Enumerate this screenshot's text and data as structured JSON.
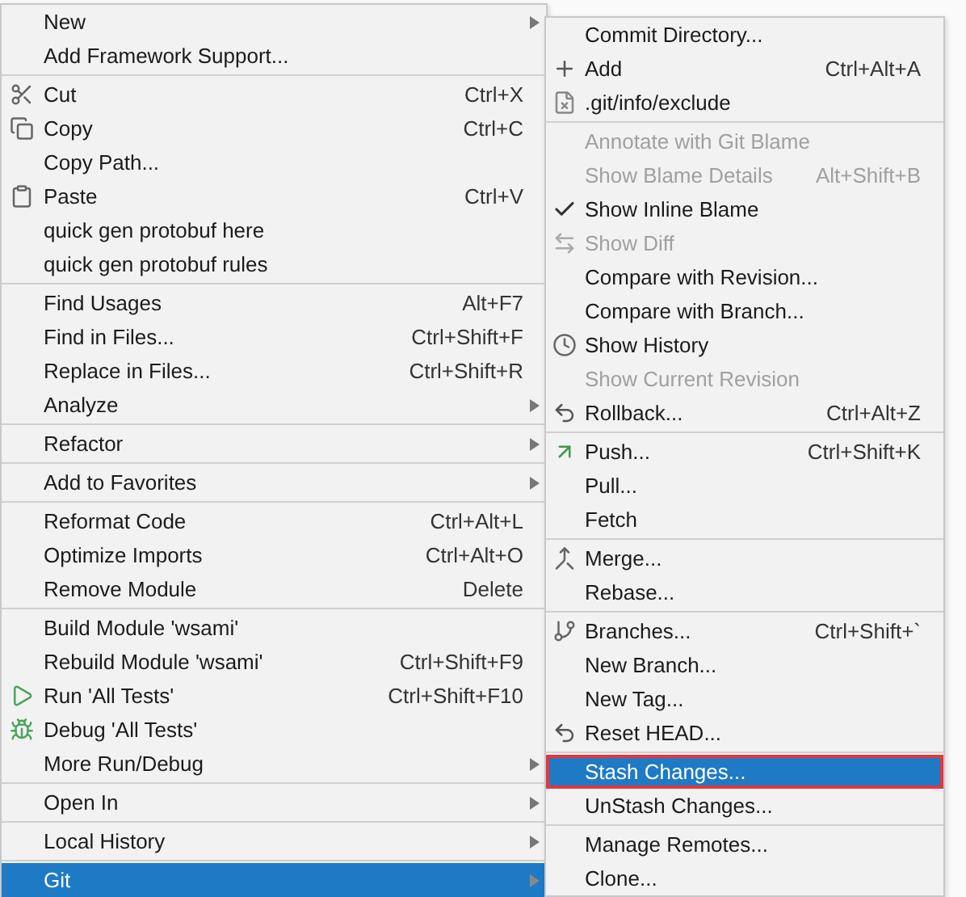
{
  "context_menu": {
    "groups": [
      [
        {
          "label": "New",
          "kind": "plain",
          "submenu": true,
          "selected": false
        },
        {
          "label": "Add Framework Support...",
          "kind": "plain",
          "selected": false
        }
      ],
      [
        {
          "label": "Cut",
          "shortcut": "Ctrl+X",
          "kind": "scissors",
          "selected": false
        },
        {
          "label": "Copy",
          "shortcut": "Ctrl+C",
          "kind": "copy",
          "selected": false
        },
        {
          "label": "Copy Path...",
          "kind": "plain",
          "selected": false
        },
        {
          "label": "Paste",
          "shortcut": "Ctrl+V",
          "kind": "paste",
          "selected": false
        },
        {
          "label": "quick gen protobuf here",
          "kind": "plain",
          "selected": false
        },
        {
          "label": "quick gen protobuf rules",
          "kind": "plain",
          "selected": false
        }
      ],
      [
        {
          "label": "Find Usages",
          "shortcut": "Alt+F7",
          "kind": "plain",
          "selected": false
        },
        {
          "label": "Find in Files...",
          "shortcut": "Ctrl+Shift+F",
          "kind": "plain",
          "selected": false
        },
        {
          "label": "Replace in Files...",
          "shortcut": "Ctrl+Shift+R",
          "kind": "plain",
          "selected": false
        },
        {
          "label": "Analyze",
          "kind": "plain",
          "submenu": true,
          "selected": false
        }
      ],
      [
        {
          "label": "Refactor",
          "kind": "plain",
          "submenu": true,
          "selected": false
        }
      ],
      [
        {
          "label": "Add to Favorites",
          "kind": "plain",
          "submenu": true,
          "selected": false
        }
      ],
      [
        {
          "label": "Reformat Code",
          "shortcut": "Ctrl+Alt+L",
          "kind": "plain",
          "selected": false
        },
        {
          "label": "Optimize Imports",
          "shortcut": "Ctrl+Alt+O",
          "kind": "plain",
          "selected": false
        },
        {
          "label": "Remove Module",
          "shortcut": "Delete",
          "kind": "plain",
          "selected": false
        }
      ],
      [
        {
          "label": "Build Module 'wsami'",
          "kind": "plain",
          "selected": false
        },
        {
          "label": "Rebuild Module 'wsami'",
          "shortcut": "Ctrl+Shift+F9",
          "kind": "plain",
          "selected": false
        },
        {
          "label": "Run 'All Tests'",
          "shortcut": "Ctrl+Shift+F10",
          "kind": "run",
          "selected": false
        },
        {
          "label": "Debug 'All Tests'",
          "kind": "debug",
          "selected": false
        },
        {
          "label": "More Run/Debug",
          "kind": "plain",
          "submenu": true,
          "selected": false
        }
      ],
      [
        {
          "label": "Open In",
          "kind": "plain",
          "submenu": true,
          "selected": false
        }
      ],
      [
        {
          "label": "Local History",
          "kind": "plain",
          "submenu": true,
          "selected": false
        }
      ],
      [
        {
          "label": "Git",
          "kind": "plain",
          "submenu": true,
          "selected": true
        }
      ]
    ]
  },
  "git_submenu": {
    "groups": [
      [
        {
          "label": "Commit Directory...",
          "kind": "plain",
          "selected": false
        },
        {
          "label": "Add",
          "shortcut": "Ctrl+Alt+A",
          "kind": "plus",
          "selected": false
        },
        {
          "label": ".git/info/exclude",
          "kind": "exclude",
          "selected": false
        }
      ],
      [
        {
          "label": "Annotate with Git Blame",
          "kind": "plain",
          "disabled": true,
          "selected": false
        },
        {
          "label": "Show Blame Details",
          "shortcut": "Alt+Shift+B",
          "kind": "plain",
          "disabled": true,
          "selected": false
        },
        {
          "label": "Show Inline Blame",
          "kind": "plain",
          "checked": true,
          "selected": false
        },
        {
          "label": "Show Diff",
          "kind": "diff",
          "disabled": true,
          "selected": false
        },
        {
          "label": "Compare with Revision...",
          "kind": "plain",
          "selected": false
        },
        {
          "label": "Compare with Branch...",
          "kind": "plain",
          "selected": false
        },
        {
          "label": "Show History",
          "kind": "clock",
          "selected": false
        },
        {
          "label": "Show Current Revision",
          "kind": "plain",
          "disabled": true,
          "selected": false
        },
        {
          "label": "Rollback...",
          "shortcut": "Ctrl+Alt+Z",
          "kind": "undo",
          "selected": false
        }
      ],
      [
        {
          "label": "Push...",
          "shortcut": "Ctrl+Shift+K",
          "kind": "push",
          "selected": false
        },
        {
          "label": "Pull...",
          "kind": "plain",
          "selected": false
        },
        {
          "label": "Fetch",
          "kind": "plain",
          "selected": false
        }
      ],
      [
        {
          "label": "Merge...",
          "kind": "merge",
          "selected": false
        },
        {
          "label": "Rebase...",
          "kind": "plain",
          "selected": false
        }
      ],
      [
        {
          "label": "Branches...",
          "shortcut": "Ctrl+Shift+`",
          "kind": "branch",
          "selected": false
        },
        {
          "label": "New Branch...",
          "kind": "plain",
          "selected": false
        },
        {
          "label": "New Tag...",
          "kind": "plain",
          "selected": false
        },
        {
          "label": "Reset HEAD...",
          "kind": "undo",
          "selected": false
        }
      ],
      [
        {
          "label": "Stash Changes...",
          "kind": "plain",
          "selected": true,
          "outlined": true
        },
        {
          "label": "UnStash Changes...",
          "kind": "plain",
          "selected": false
        }
      ],
      [
        {
          "label": "Manage Remotes...",
          "kind": "plain",
          "selected": false
        },
        {
          "label": "Clone...",
          "kind": "plain",
          "selected": false
        }
      ]
    ]
  }
}
